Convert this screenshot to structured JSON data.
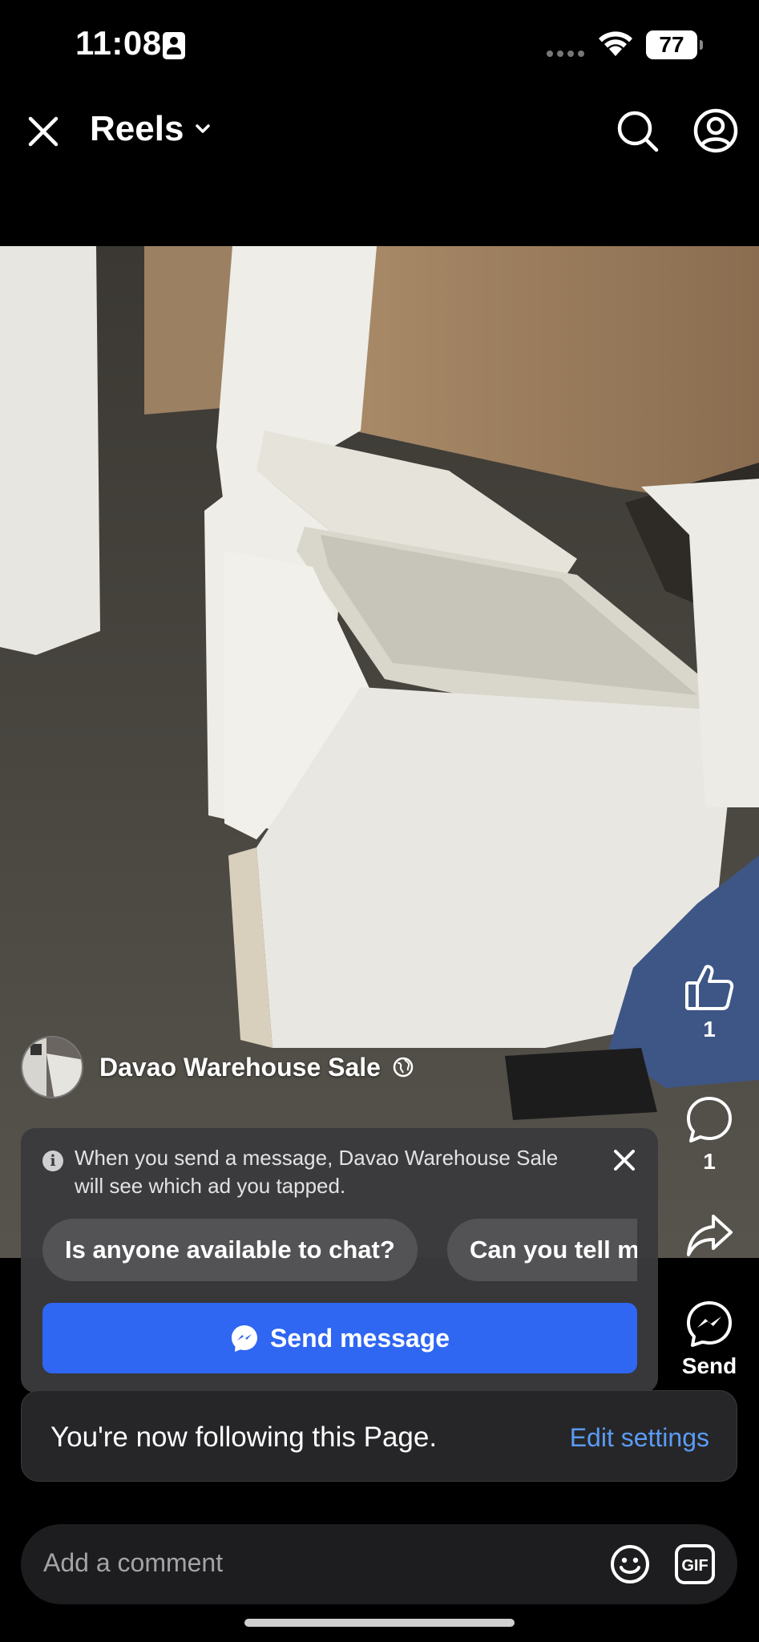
{
  "status_bar": {
    "time": "11:08",
    "battery": "77"
  },
  "header": {
    "title": "Reels"
  },
  "post": {
    "page_name": "Davao Warehouse Sale",
    "likes": "1",
    "comments": "1",
    "send_label": "Send"
  },
  "message_panel": {
    "info_text": "When you send a message, Davao Warehouse Sale will see which ad you tapped.",
    "quick_replies": [
      "Is anyone available to chat?",
      "Can you tell me more about this?"
    ],
    "send_button": "Send message"
  },
  "follow_toast": {
    "text": "You're now following this Page.",
    "action": "Edit settings"
  },
  "comment": {
    "placeholder": "Add a comment"
  },
  "colors": {
    "primary_blue": "#2f66f2",
    "link_blue": "#5b9bf6"
  }
}
